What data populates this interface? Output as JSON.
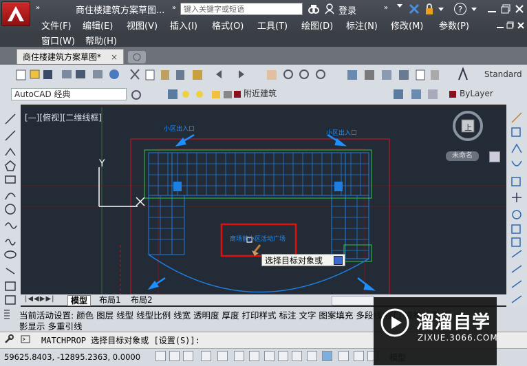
{
  "app": {
    "document_title": "商住楼建筑方案草图...",
    "search_placeholder": "键入关键字或短语",
    "login_label": "登录",
    "menu_row1": [
      "文件(F)",
      "编辑(E)",
      "视图(V)",
      "插入(I)",
      "格式(O)",
      "工具(T)",
      "绘图(D)",
      "标注(N)",
      "修改(M)",
      "参数(P)"
    ],
    "menu_row2": [
      "窗口(W)",
      "帮助(H)"
    ],
    "help_label": "?"
  },
  "tabs": {
    "active_label": "商住楼建筑方案草图*",
    "close_symbol": "×"
  },
  "toolbar": {
    "text_style": "Standard",
    "workspace": "AutoCAD 经典",
    "layer_name": "附近建筑",
    "color_value": "ByLayer"
  },
  "viewport": {
    "label": "[—][俯视][二维线框]",
    "ucs_y": "Y",
    "nav_center": "上",
    "nav_unnamed": "未命名",
    "annotations": {
      "entrance_left": "小区出入口",
      "entrance_right": "小区出入口",
      "plaza": "商场前小区活动广场"
    },
    "tooltip": "选择目标对象或"
  },
  "layout_tabs": [
    "模型",
    "布局1",
    "布局2"
  ],
  "command": {
    "history_line1": "当前活动设置:  颜色 图层 线型 线型比例 线宽 透明度 厚度 打印样式 标注 文字 图案填充 多段线 视口 表格材质 阴",
    "history_line2": "影显示 多重引线",
    "prompt_cmd": "MATCHPROP",
    "prompt_text": "选择目标对象或 [设置(S)]:"
  },
  "status": {
    "coordinates": "59625.8403, -12895.2363, 0.0000",
    "model_label": "模型"
  },
  "watermark": {
    "brand": "溜溜自学",
    "url": "ZIXUE.3066.COM"
  },
  "colors": {
    "drawing_bg": "#232b36",
    "building_blue": "#1e90ff",
    "green": "#2ecc40",
    "red": "#c0202a",
    "highlight_red": "#e01010"
  }
}
